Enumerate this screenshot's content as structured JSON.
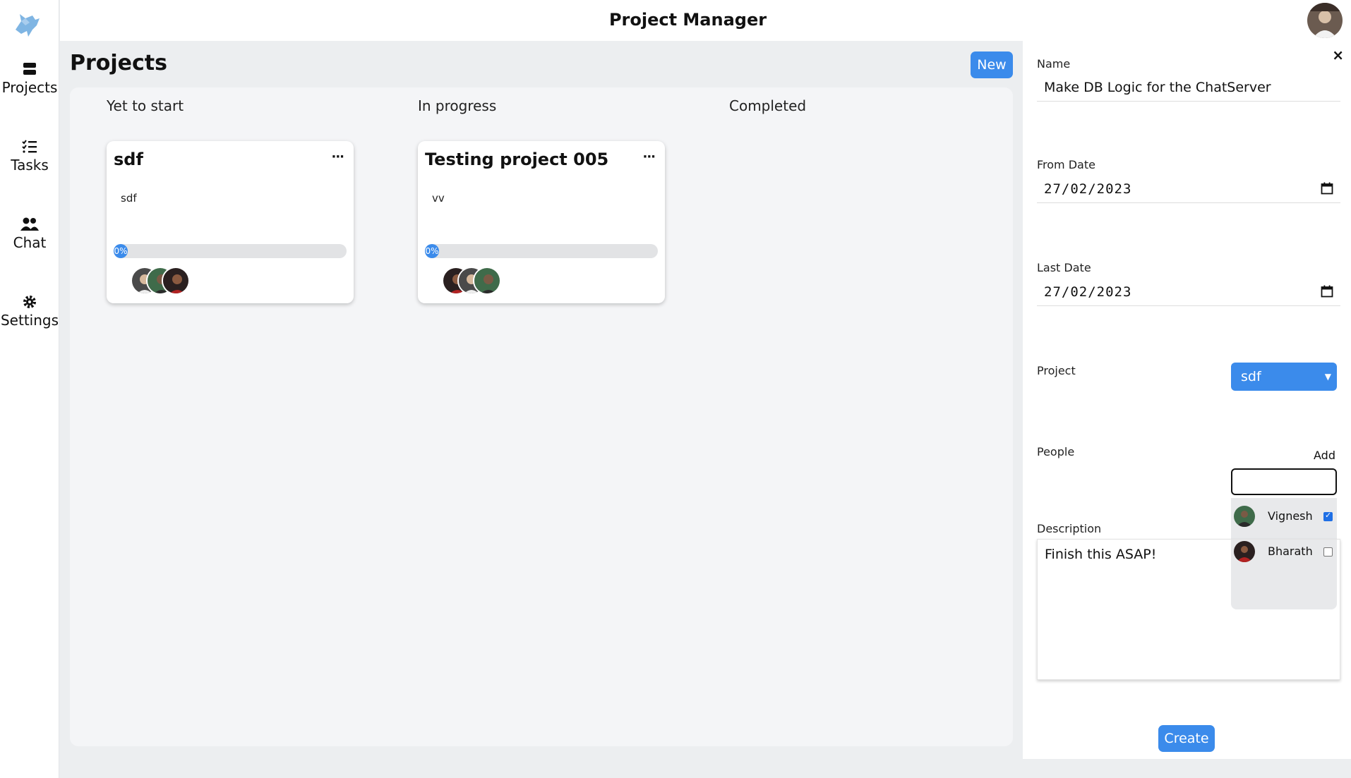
{
  "app": {
    "title": "Project Manager"
  },
  "sidebar": {
    "items": [
      {
        "label": "Projects",
        "icon": "server-icon"
      },
      {
        "label": "Tasks",
        "icon": "list-icon"
      },
      {
        "label": "Chat",
        "icon": "users-icon"
      },
      {
        "label": "Settings",
        "icon": "gear-icon"
      }
    ]
  },
  "main": {
    "title": "Projects",
    "new_label": "New",
    "columns": [
      "Yet to start",
      "In progress",
      "Completed"
    ],
    "cards": [
      {
        "title": "sdf",
        "description": "sdf",
        "progress": 0,
        "progress_label": "0%",
        "menu": "···"
      },
      {
        "title": "Testing project 005",
        "description": "vv",
        "progress": 0,
        "progress_label": "0%",
        "menu": "···"
      }
    ]
  },
  "panel": {
    "close": "×",
    "name_label": "Name",
    "name_value": "Make DB Logic for the ChatServer",
    "from_label": "From Date",
    "from_value": "27/02/2023",
    "last_label": "Last Date",
    "last_value": "27/02/2023",
    "project_label": "Project",
    "project_value": "sdf",
    "people_label": "People",
    "add_label": "Add",
    "people": [
      {
        "name": "Vignesh",
        "checked": true
      },
      {
        "name": "Bharath",
        "checked": false
      }
    ],
    "description_label": "Description",
    "description_value": "Finish this ASAP!",
    "create_label": "Create"
  },
  "colors": {
    "accent": "#3b8beb",
    "background": "#eceef0",
    "board": "#f4f5f7"
  }
}
